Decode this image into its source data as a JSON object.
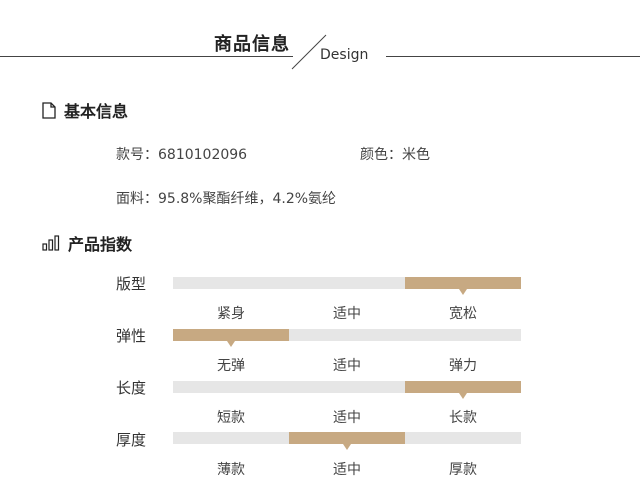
{
  "header": {
    "title": "商品信息",
    "subtitle": "Design"
  },
  "basic": {
    "heading": "基本信息",
    "style_no": "款号：6810102096",
    "color": "颜色：米色",
    "fabric": "面料：95.8%聚酯纤维，4.2%氨纶"
  },
  "index": {
    "heading": "产品指数",
    "rows": [
      {
        "label": "版型",
        "options": [
          "紧身",
          "适中",
          "宽松"
        ],
        "selected": 2
      },
      {
        "label": "弹性",
        "options": [
          "无弹",
          "适中",
          "弹力"
        ],
        "selected": 0
      },
      {
        "label": "长度",
        "options": [
          "短款",
          "适中",
          "长款"
        ],
        "selected": 2
      },
      {
        "label": "厚度",
        "options": [
          "薄款",
          "适中",
          "厚款"
        ],
        "selected": 1
      }
    ]
  },
  "colors": {
    "accent": "#c7a982",
    "track": "#e6e6e6"
  }
}
